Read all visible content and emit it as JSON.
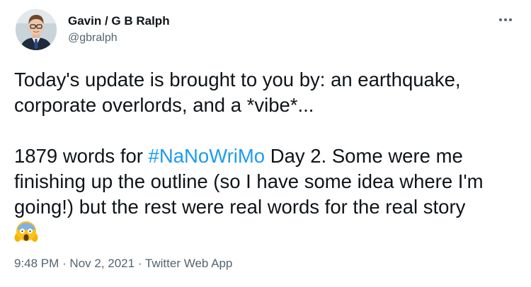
{
  "author": {
    "display_name": "Gavin / G B Ralph",
    "handle": "@gbralph"
  },
  "menu_icon": "more-horizontal-icon",
  "tweet": {
    "line1": "Today's update is brought to you by: an earthquake,",
    "line2": "corporate overlords, and a *vibe*...",
    "line3_prefix": "1879 words for ",
    "hashtag": "#NaNoWriMo",
    "line3_suffix": " Day 2. Some were me",
    "line4": "finishing up the outline (so I have some idea where I'm",
    "line5": "going!) but the rest were real words for the real story",
    "emoji": "screaming-face-emoji"
  },
  "meta": {
    "time": "9:48 PM",
    "separator1": " · ",
    "date": "Nov 2, 2021",
    "separator2": " · ",
    "source": "Twitter Web App"
  },
  "colors": {
    "link": "#1d9bf0",
    "secondary_text": "#536471",
    "primary_text": "#0f1419"
  }
}
